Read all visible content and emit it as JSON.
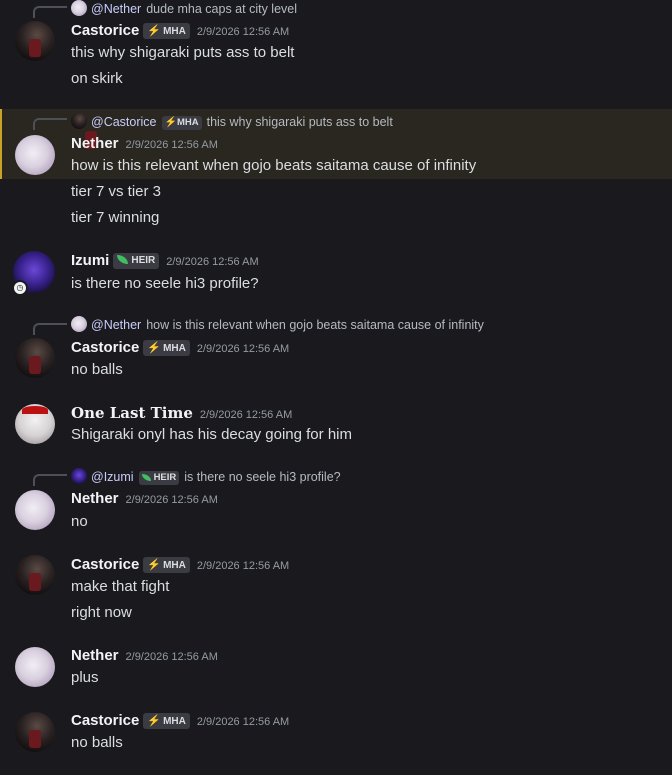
{
  "messages": {
    "m1": {
      "reply": {
        "author": "@Nether",
        "text": "dude mha caps at city level"
      },
      "author": "Castorice",
      "tag": "MHA",
      "time": "2/9/2026 12:56 AM",
      "lines": [
        "this why shigaraki puts ass to belt",
        "on skirk"
      ]
    },
    "m2": {
      "reply": {
        "author": "@Castorice",
        "tag": "MHA",
        "text": "this why shigaraki puts ass to belt"
      },
      "author": "Nether",
      "time": "2/9/2026 12:56 AM",
      "lines": [
        "how is this relevant when gojo beats saitama cause of infinity",
        "tier 7 vs tier 3",
        "tier 7 winning"
      ]
    },
    "m3": {
      "author": "Izumi",
      "tag": "HEIR",
      "time": "2/9/2026 12:56 AM",
      "lines": [
        "is there no seele hi3 profile?"
      ]
    },
    "m4": {
      "reply": {
        "author": "@Nether",
        "text": "how is this relevant when gojo beats saitama cause of infinity"
      },
      "author": "Castorice",
      "tag": "MHA",
      "time": "2/9/2026 12:56 AM",
      "lines": [
        "no balls"
      ]
    },
    "m5": {
      "author": "One Last Time",
      "time": "2/9/2026 12:56 AM",
      "lines": [
        "Shigaraki onyl has his decay going for him"
      ]
    },
    "m6": {
      "reply": {
        "author": "@Izumi",
        "tag": "HEIR",
        "text": "is there no seele hi3 profile?"
      },
      "author": "Nether",
      "time": "2/9/2026 12:56 AM",
      "lines": [
        "no"
      ]
    },
    "m7": {
      "author": "Castorice",
      "tag": "MHA",
      "time": "2/9/2026 12:56 AM",
      "lines": [
        "make that fight",
        "right now"
      ]
    },
    "m8": {
      "author": "Nether",
      "time": "2/9/2026 12:56 AM",
      "lines": [
        "plus"
      ]
    },
    "m9": {
      "author": "Castorice",
      "tag": "MHA",
      "time": "2/9/2026 12:56 AM",
      "lines": [
        "no balls"
      ]
    }
  },
  "colors": {
    "accent_highlight": "#c9a227",
    "background": "#1a1a1e",
    "mention": "#c9cdfb"
  }
}
